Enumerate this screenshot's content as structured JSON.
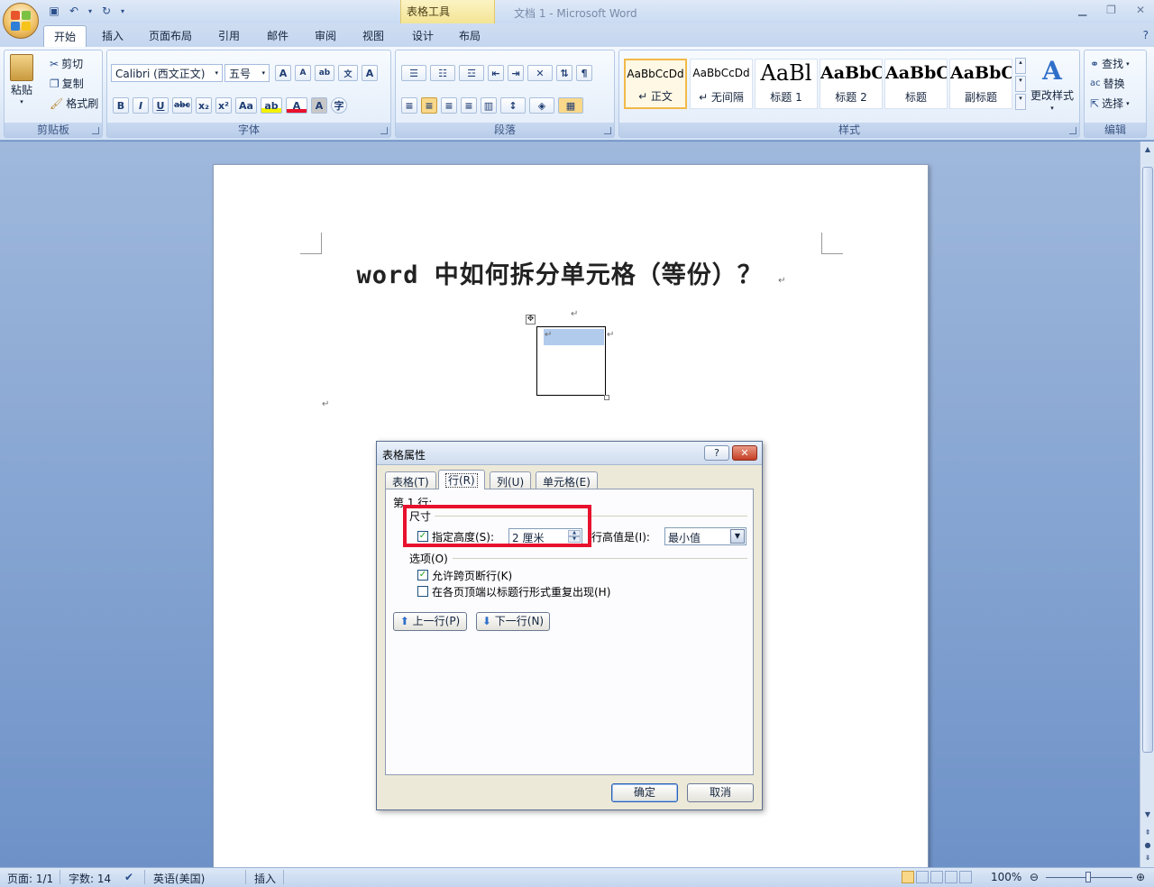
{
  "titlebar": {
    "context_tab_group": "表格工具",
    "window_title": "文档 1 - Microsoft Word",
    "minimize": "▁",
    "restore": "❐",
    "close": "✕"
  },
  "tabs": [
    "开始",
    "插入",
    "页面布局",
    "引用",
    "邮件",
    "审阅",
    "视图",
    "设计",
    "布局"
  ],
  "ribbon": {
    "clipboard": {
      "paste": "粘贴",
      "cut": "剪切",
      "copy": "复制",
      "format_painter": "格式刷",
      "label": "剪贴板"
    },
    "font": {
      "font_name": "Calibri (西文正文)",
      "font_size": "五号",
      "label": "字体"
    },
    "paragraph": {
      "label": "段落"
    },
    "styles": {
      "label": "样式",
      "items": [
        {
          "sample": "AaBbCcDd",
          "name": "↵ 正文"
        },
        {
          "sample": "AaBbCcDd",
          "name": "↵ 无间隔"
        },
        {
          "sample": "AaBl",
          "name": "标题 1"
        },
        {
          "sample": "AaBbC",
          "name": "标题 2"
        },
        {
          "sample": "AaBbC",
          "name": "标题"
        },
        {
          "sample": "AaBbC",
          "name": "副标题"
        }
      ],
      "change_styles": "更改样式"
    },
    "editing": {
      "find": "查找",
      "replace": "替换",
      "select": "选择",
      "label": "编辑"
    }
  },
  "document": {
    "heading": "word 中如何拆分单元格（等份）？",
    "paragraph_mark": "↵",
    "table_move_handle": "✥"
  },
  "dialog": {
    "title": "表格属性",
    "help": "?",
    "close": "✕",
    "tabs": [
      "表格(T)",
      "行(R)",
      "列(U)",
      "单元格(E)"
    ],
    "row_heading": "第 1 行:",
    "size_legend": "尺寸",
    "specify_height_label": "指定高度(S):",
    "specify_height_checked": true,
    "height_value": "2 厘米",
    "row_height_is_label": "行高值是(I):",
    "row_height_is_value": "最小值",
    "options_legend": "选项(O)",
    "allow_break_label": "允许跨页断行(K)",
    "allow_break_checked": true,
    "repeat_header_label": "在各页顶端以标题行形式重复出现(H)",
    "repeat_header_checked": false,
    "prev_row": "上一行(P)",
    "next_row": "下一行(N)",
    "ok": "确定",
    "cancel": "取消"
  },
  "statusbar": {
    "page": "页面: 1/1",
    "words": "字数: 14",
    "language": "英语(美国)",
    "mode": "插入",
    "zoom": "100%"
  },
  "colors": {
    "highlight_box": "#e8112d",
    "cell_selection": "#b0cbec",
    "workspace": "#6e92c8"
  }
}
